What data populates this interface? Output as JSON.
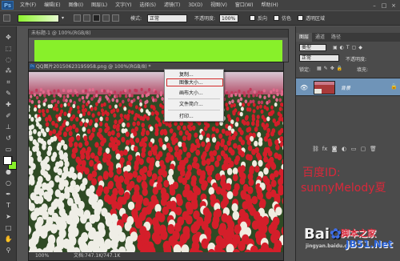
{
  "app": {
    "logo": "Ps"
  },
  "menu": [
    "文件(F)",
    "编辑(E)",
    "图像(I)",
    "图层(L)",
    "文字(Y)",
    "选择(S)",
    "滤镜(T)",
    "3D(D)",
    "视图(V)",
    "窗口(W)",
    "帮助(H)"
  ],
  "window_controls": [
    "–",
    "□",
    "×"
  ],
  "options": {
    "gradient_colors": [
      "#8cf32d",
      "#e6fbd0"
    ],
    "mode_label": "模式:",
    "mode_value": "正常",
    "opacity_label": "不透明度:",
    "opacity_value": "100%",
    "reverse_label": "反向",
    "dither_label": "仿色",
    "transparency_label": "透明区域"
  },
  "documents": {
    "doc1_title": "未标题-1 @ 100%(RGB/8)",
    "doc2_title": "QQ图片20150623195958.png @ 100%(RGB/8) *",
    "zoom": "100%",
    "status": "文档:747.1K/747.1K"
  },
  "context_menu": {
    "items": [
      "复制...",
      "图像大小...",
      "画布大小...",
      "文件简介...",
      "打印..."
    ],
    "highlighted": "图像大小..."
  },
  "panel": {
    "tabs": [
      "图层",
      "通道",
      "路径"
    ],
    "filter_label": "类型",
    "blend_mode": "正常",
    "opacity_label": "不透明度:",
    "lock_label": "锁定:",
    "fill_label": "填充:",
    "layer_name": "背景"
  },
  "caption": {
    "line1": "百度ID:",
    "line2": "sunnyMelody夏"
  },
  "watermark": {
    "main": "Bai",
    "paw": "du",
    "site": "脚本之家",
    "url": "jingyan.baidu.com",
    "jb": "JB51.Net"
  },
  "colors": {
    "accent_red": "#d8283a",
    "canvas_green": "#88f02a",
    "selection": "#6f94b8"
  }
}
